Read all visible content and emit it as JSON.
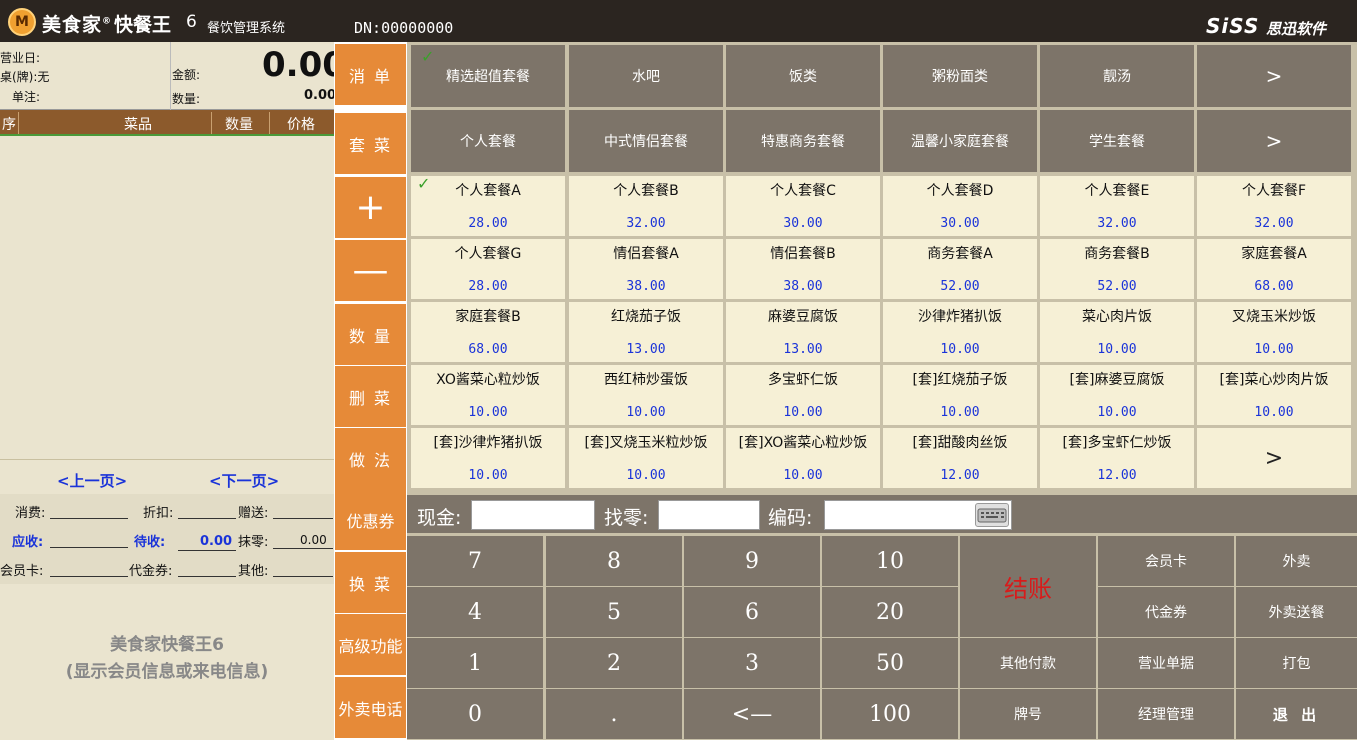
{
  "titlebar": {
    "logo_glyph": "M",
    "brand": "美食家",
    "brand_mark": "®",
    "product": "快餐王",
    "version": "6",
    "subtitle": "餐饮管理系统",
    "dn": "DN:00000000",
    "vendor": "SiSS",
    "vendor_cn": "思迅软件"
  },
  "bizinfo": {
    "business_day_label": "营业日:",
    "table_label": "桌(牌):无",
    "note_label": "单注:",
    "amount_label": "金额:",
    "amount_value": "0.00",
    "quantity_label": "数量:",
    "quantity_value": "0.00"
  },
  "order_columns": [
    "序",
    "菜品",
    "数量",
    "价格"
  ],
  "pager": {
    "prev": "<上一页>",
    "next": "<下一页>"
  },
  "summary": {
    "consume_label": "消费:",
    "discount_label": "折扣:",
    "gift_label": "赠送:",
    "receivable_label": "应收:",
    "pending_label": "待收:",
    "pending_value": "0.00",
    "rounding_label": "抹零:",
    "rounding_value": "0.00",
    "member_card_label": "会员卡:",
    "voucher_label": "代金券:",
    "other_label": "其他:"
  },
  "member_info": {
    "line1": "美食家快餐王6",
    "line2": "(显示会员信息或来电信息)"
  },
  "menu": [
    "消 单",
    "套 菜",
    "+",
    "—",
    "数 量",
    "删 菜",
    "做 法",
    "优惠券",
    "换 菜",
    "高级功能",
    "外卖电话"
  ],
  "check_mark": "✓",
  "categories_row1": [
    "精选超值套餐",
    "水吧",
    "饭类",
    "粥粉面类",
    "靓汤",
    ">"
  ],
  "categories_row2": [
    "个人套餐",
    "中式情侣套餐",
    "特惠商务套餐",
    "温馨小家庭套餐",
    "学生套餐",
    ">"
  ],
  "dishes": [
    {
      "name": "个人套餐A",
      "price": "28.00"
    },
    {
      "name": "个人套餐B",
      "price": "32.00"
    },
    {
      "name": "个人套餐C",
      "price": "30.00"
    },
    {
      "name": "个人套餐D",
      "price": "30.00"
    },
    {
      "name": "个人套餐E",
      "price": "32.00"
    },
    {
      "name": "个人套餐F",
      "price": "32.00"
    },
    {
      "name": "个人套餐G",
      "price": "28.00"
    },
    {
      "name": "情侣套餐A",
      "price": "38.00"
    },
    {
      "name": "情侣套餐B",
      "price": "38.00"
    },
    {
      "name": "商务套餐A",
      "price": "52.00"
    },
    {
      "name": "商务套餐B",
      "price": "52.00"
    },
    {
      "name": "家庭套餐A",
      "price": "68.00"
    },
    {
      "name": "家庭套餐B",
      "price": "68.00"
    },
    {
      "name": "红烧茄子饭",
      "price": "13.00"
    },
    {
      "name": "麻婆豆腐饭",
      "price": "13.00"
    },
    {
      "name": "沙律炸猪扒饭",
      "price": "10.00"
    },
    {
      "name": "菜心肉片饭",
      "price": "10.00"
    },
    {
      "name": "叉烧玉米炒饭",
      "price": "10.00"
    },
    {
      "name": "XO酱菜心粒炒饭",
      "price": "10.00"
    },
    {
      "name": "西红柿炒蛋饭",
      "price": "10.00"
    },
    {
      "name": "多宝虾仁饭",
      "price": "10.00"
    },
    {
      "name": "[套]红烧茄子饭",
      "price": "10.00"
    },
    {
      "name": "[套]麻婆豆腐饭",
      "price": "10.00"
    },
    {
      "name": "[套]菜心炒肉片饭",
      "price": "10.00"
    },
    {
      "name": "[套]沙律炸猪扒饭",
      "price": "10.00"
    },
    {
      "name": "[套]叉烧玉米粒炒饭",
      "price": "10.00"
    },
    {
      "name": "[套]XO酱菜心粒炒饭",
      "price": "10.00"
    },
    {
      "name": "[套]甜酸肉丝饭",
      "price": "12.00"
    },
    {
      "name": "[套]多宝虾仁炒饭",
      "price": "12.00"
    }
  ],
  "dish_next": ">",
  "payment": {
    "cash_label": "现金:",
    "change_label": "找零:",
    "code_label": "编码:",
    "cash_value": "",
    "change_value": "",
    "code_value": ""
  },
  "keypad": {
    "digits": [
      "7",
      "8",
      "9",
      "10",
      "4",
      "5",
      "6",
      "20",
      "1",
      "2",
      "3",
      "50",
      "0",
      ".",
      "<—",
      "100"
    ],
    "checkout": "结账",
    "functions": [
      "会员卡",
      "外卖",
      "代金券",
      "外卖送餐",
      "其他付款",
      "营业单据",
      "打包",
      "牌号",
      "经理管理",
      "退 出"
    ]
  },
  "colors": {
    "orange_menu": "#e68a38",
    "dark_tile": "#7d7469",
    "dish_tile": "#f6f0d6",
    "price_blue": "#1a33d9",
    "checkout_red": "#d81b1b"
  }
}
